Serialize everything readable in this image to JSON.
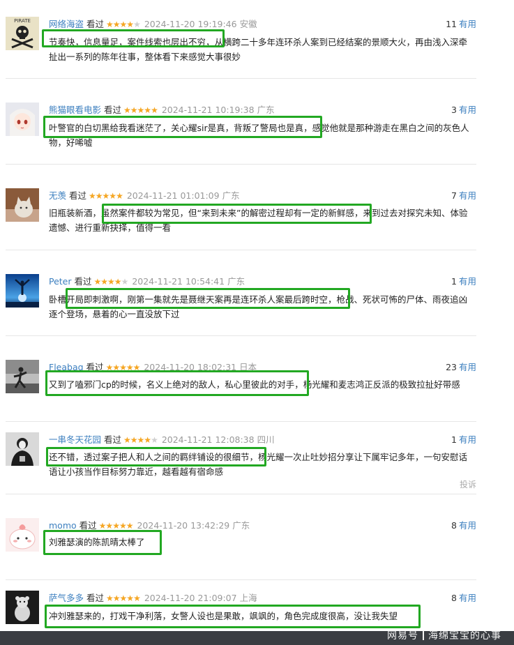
{
  "reviews": [
    {
      "user": "网络海盗",
      "seen": "看过",
      "stars": 4,
      "time": "2024-11-20 19:19:46",
      "location": "安徽",
      "votes": "11",
      "votes_label": "有用",
      "content": "节奏快，信息量足，案件线索也层出不穷，从横跨二十多年连环杀人案到已经结案的景顺大火，再由浅入深牵扯出一系列的陈年往事，整体看下来感觉大事很妙",
      "avatar_icon": "pirate-skull-icon",
      "avatar_caption": "PIRATE"
    },
    {
      "user": "熊猫眼看电影",
      "seen": "看过",
      "stars": 5,
      "time": "2024-11-21 10:19:38",
      "location": "广东",
      "votes": "3",
      "votes_label": "有用",
      "content": "叶警官的白切黑给我看迷茫了，关心耀sir是真，背叛了警局也是真，感觉他就是那种游走在黑白之间的灰色人物，好唏嘘",
      "avatar_icon": "anime-girl-icon"
    },
    {
      "user": "无羡",
      "seen": "看过",
      "stars": 5,
      "time": "2024-11-21 01:01:09",
      "location": "广东",
      "votes": "7",
      "votes_label": "有用",
      "content": "旧瓶装新酒，虽然案件都较为常见，但“来到未来”的解密过程却有一定的新鲜感，来到过去对探究未知、体验遗憾、进行重新抉择，值得一看",
      "avatar_icon": "cat-icon"
    },
    {
      "user": "Peter",
      "seen": "看过",
      "stars": 4,
      "time": "2024-11-21 10:54:41",
      "location": "广东",
      "votes": "1",
      "votes_label": "有用",
      "content": "卧槽开局即刺激啊，刚第一集就先是聂继天案再是连环杀人案最后跨时空，枪战、死状可怖的尸体、雨夜追凶逐个登场，悬着的心一直没放下过",
      "avatar_icon": "sunset-silhouette-icon"
    },
    {
      "user": "Fleabag",
      "seen": "看过",
      "stars": 5,
      "time": "2024-11-20 18:02:31",
      "location": "日本",
      "votes": "23",
      "votes_label": "有用",
      "content": "又到了嗑邪门cp的时候，名义上绝对的敌人，私心里彼此的对手，杨光耀和麦志鸿正反派的极致拉扯好带感",
      "avatar_icon": "runner-photo-icon"
    },
    {
      "user": "一串冬天花园",
      "seen": "看过",
      "stars": 4,
      "time": "2024-11-21 12:08:38",
      "location": "四川",
      "votes": "1",
      "votes_label": "有用",
      "content": "还不错，透过案子把人和人之间的羁绊铺设的很细节，杨光耀一次止吐妙招分享让下属牢记多年，一句安慰话语让小孩当作目标努力靠近，越看越有宿命感",
      "avatar_icon": "person-photo-icon",
      "report": "投诉"
    },
    {
      "user": "momo",
      "seen": "看过",
      "stars": 5,
      "time": "2024-11-20 13:42:29",
      "location": "广东",
      "votes": "8",
      "votes_label": "有用",
      "content": "刘雅瑟演的陈凯晴太棒了",
      "avatar_icon": "pink-blob-icon"
    },
    {
      "user": "萨气多多",
      "seen": "看过",
      "stars": 5,
      "time": "2024-11-20 21:09:07",
      "location": "上海",
      "votes": "8",
      "votes_label": "有用",
      "content": "冲刘雅瑟来的，打戏干净利落，女警人设也是果敢，飒飒的，角色完成度很高，没让我失望",
      "avatar_icon": "bear-photo-icon"
    }
  ],
  "watermark": {
    "left": "网易号",
    "right": "海绵宝宝的心事"
  },
  "colors": {
    "highlight": "#22a822",
    "link": "#3c7fbf",
    "star": "#f5a623"
  }
}
